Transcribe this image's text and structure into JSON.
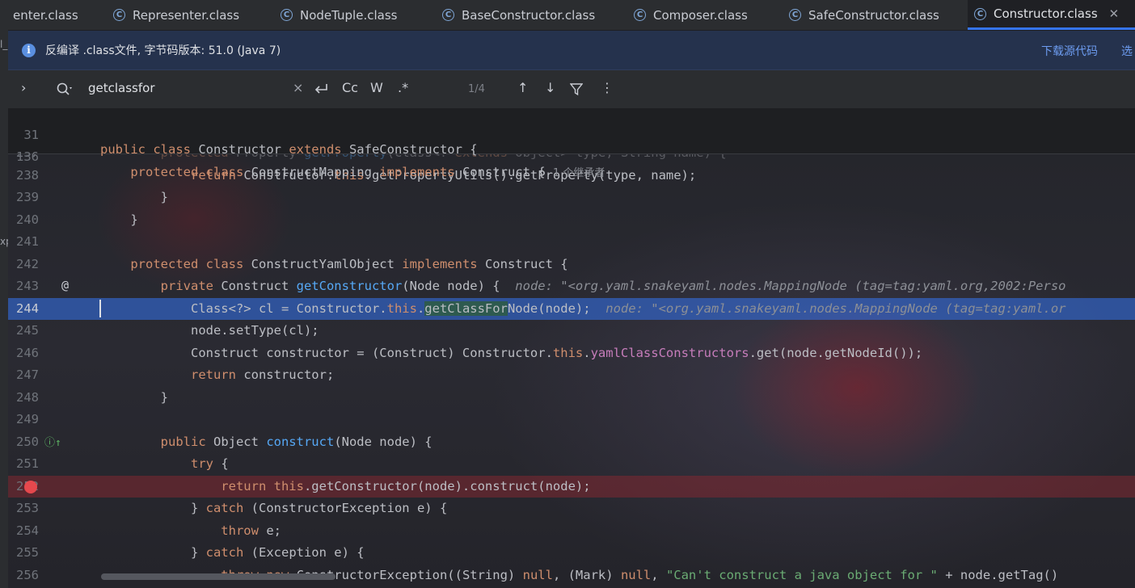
{
  "tabs": [
    {
      "label": "enter.class",
      "icon": "none"
    },
    {
      "label": "Representer.class",
      "icon": "class-icon"
    },
    {
      "label": "NodeTuple.class",
      "icon": "class-gear-icon"
    },
    {
      "label": "BaseConstructor.class",
      "icon": "class-icon"
    },
    {
      "label": "Composer.class",
      "icon": "class-icon"
    },
    {
      "label": "SafeConstructor.class",
      "icon": "class-icon"
    },
    {
      "label": "Constructor.class",
      "icon": "class-icon",
      "active": true,
      "close": "✕"
    }
  ],
  "banner": {
    "text": "反编译 .class文件, 字节码版本: 51.0 (Java 7)",
    "link1": "下载源代码",
    "link2": "选"
  },
  "search": {
    "query": "getclassfor",
    "count": "1/4",
    "clear": "×",
    "regex_cc": "Cc",
    "regex_w": "W",
    "regex_re": ".*"
  },
  "left_edge_marks": [
    "l_",
    "xp"
  ],
  "sticky": [
    {
      "num": "31",
      "tokens": [
        [
          "kw",
          "public "
        ],
        [
          "kw",
          "class "
        ],
        [
          "pl",
          "Constructor "
        ],
        [
          "kw",
          "extends "
        ],
        [
          "pl",
          "SafeConstructor {"
        ]
      ]
    },
    {
      "num": "136",
      "tokens": [
        [
          "kw",
          "    protected "
        ],
        [
          "kw",
          "class "
        ],
        [
          "pl",
          "ConstructMapping "
        ],
        [
          "kw",
          "implements "
        ],
        [
          "pl",
          "Construct { "
        ]
      ],
      "inherit": "1 个继承者"
    }
  ],
  "lines": [
    {
      "num": "237",
      "faded": true,
      "tokens": [
        [
          "kw",
          "        protected "
        ],
        [
          "pl",
          "Property "
        ],
        [
          "fn",
          "getProperty"
        ],
        [
          "pl",
          "(Class<? "
        ],
        [
          "kw",
          "extends "
        ],
        [
          "pl",
          "Object> type, String name) {"
        ]
      ]
    },
    {
      "num": "238",
      "tokens": [
        [
          "kw",
          "            return "
        ],
        [
          "pl",
          "Constructor."
        ],
        [
          "kw",
          "this"
        ],
        [
          "pl",
          ".getPropertyUtils().getProperty(type, name);"
        ]
      ]
    },
    {
      "num": "239",
      "tokens": [
        [
          "pl",
          "        }"
        ]
      ]
    },
    {
      "num": "240",
      "tokens": [
        [
          "pl",
          "    }"
        ]
      ]
    },
    {
      "num": "241",
      "tokens": []
    },
    {
      "num": "242",
      "tokens": [
        [
          "kw",
          "    protected "
        ],
        [
          "kw",
          "class "
        ],
        [
          "pl",
          "ConstructYamlObject "
        ],
        [
          "kw",
          "implements "
        ],
        [
          "pl",
          "Construct {"
        ]
      ]
    },
    {
      "num": "243",
      "icon": "@",
      "tokens": [
        [
          "kw",
          "        private "
        ],
        [
          "pl",
          "Construct "
        ],
        [
          "fn",
          "getConstructor"
        ],
        [
          "pl",
          "(Node node) {  "
        ],
        [
          "hint",
          "node: \"<org.yaml.snakeyaml.nodes.MappingNode (tag=tag:yaml.org,2002:Perso"
        ]
      ]
    },
    {
      "num": "244",
      "hl": true,
      "tokens": [
        [
          "pl",
          "            Class<?> cl = Constructor."
        ],
        [
          "kw",
          "this"
        ],
        [
          "pl",
          "."
        ],
        [
          "match",
          "getClassFor"
        ],
        [
          "pl",
          "Node(node);  "
        ],
        [
          "hint",
          "node: \"<org.yaml.snakeyaml.nodes.MappingNode (tag=tag:yaml.or"
        ]
      ]
    },
    {
      "num": "245",
      "tokens": [
        [
          "pl",
          "            node.setType(cl);"
        ]
      ]
    },
    {
      "num": "246",
      "tokens": [
        [
          "pl",
          "            Construct constructor = (Construct) Constructor."
        ],
        [
          "kw",
          "this"
        ],
        [
          "pl",
          "."
        ],
        [
          "fld",
          "yamlClassConstructors"
        ],
        [
          "pl",
          ".get(node.getNodeId());"
        ]
      ]
    },
    {
      "num": "247",
      "tokens": [
        [
          "kw",
          "            return "
        ],
        [
          "pl",
          "constructor;"
        ]
      ]
    },
    {
      "num": "248",
      "tokens": [
        [
          "pl",
          "        }"
        ]
      ]
    },
    {
      "num": "249",
      "tokens": []
    },
    {
      "num": "250",
      "icon": "impl",
      "tokens": [
        [
          "kw",
          "        public "
        ],
        [
          "pl",
          "Object "
        ],
        [
          "fn",
          "construct"
        ],
        [
          "pl",
          "(Node node) {"
        ]
      ]
    },
    {
      "num": "251",
      "tokens": [
        [
          "kw",
          "            try "
        ],
        [
          "pl",
          "{"
        ]
      ]
    },
    {
      "num": "252",
      "bp": true,
      "tokens": [
        [
          "kw",
          "                return "
        ],
        [
          "kw",
          "this"
        ],
        [
          "pl",
          ".getConstructor(node).construct(node);"
        ]
      ]
    },
    {
      "num": "253",
      "tokens": [
        [
          "pl",
          "            } "
        ],
        [
          "kw",
          "catch "
        ],
        [
          "pl",
          "(ConstructorException e) {"
        ]
      ]
    },
    {
      "num": "254",
      "tokens": [
        [
          "kw",
          "                throw "
        ],
        [
          "pl",
          "e;"
        ]
      ]
    },
    {
      "num": "255",
      "tokens": [
        [
          "pl",
          "            } "
        ],
        [
          "kw",
          "catch "
        ],
        [
          "pl",
          "(Exception e) {"
        ]
      ]
    },
    {
      "num": "256",
      "tokens": [
        [
          "kw",
          "                throw "
        ],
        [
          "kw",
          "new "
        ],
        [
          "pl",
          "ConstructorException((String) "
        ],
        [
          "kw",
          "null"
        ],
        [
          "pl",
          ", (Mark) "
        ],
        [
          "kw",
          "null"
        ],
        [
          "pl",
          ", "
        ],
        [
          "str",
          "\"Can't construct a java object for \""
        ],
        [
          "pl",
          " + node.getTag()"
        ]
      ]
    }
  ]
}
